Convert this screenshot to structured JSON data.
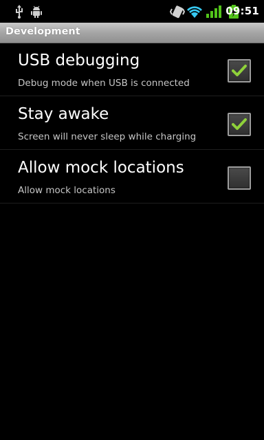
{
  "status_bar": {
    "time": "09:51",
    "icons": [
      "usb-icon",
      "android-debug-icon",
      "vibrate-icon",
      "wifi-icon",
      "signal-icon",
      "battery-charging-icon"
    ]
  },
  "header": {
    "title": "Development"
  },
  "preferences": [
    {
      "title": "USB debugging",
      "summary": "Debug mode when USB is connected",
      "checked": true
    },
    {
      "title": "Stay awake",
      "summary": "Screen will never sleep while charging",
      "checked": true
    },
    {
      "title": "Allow mock locations",
      "summary": "Allow mock locations",
      "checked": false
    }
  ],
  "colors": {
    "background": "#000000",
    "check_accent": "#8fd13a",
    "signal_accent": "#52c41a",
    "summary_text": "#c6c6c6"
  }
}
